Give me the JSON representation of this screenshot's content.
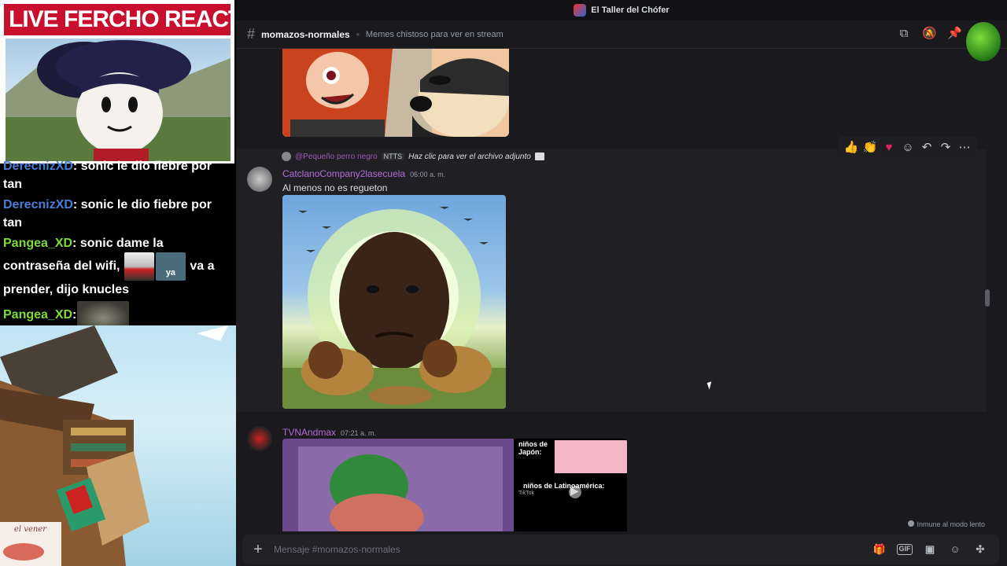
{
  "stream": {
    "cam_title": "LIVE FERCHO REACTION",
    "chat": [
      {
        "user": "DerecnizXD",
        "text": ": sonic le dio fiebre por tan"
      },
      {
        "user": "DerecnizXD",
        "text": ": sonic le dio fiebre por tan"
      },
      {
        "user": "Pangea_XD",
        "text_before": ": sonic dame la contraseña del wifi, ",
        "emote_label": "ya",
        "text_after": " va a prender, dijo knucles"
      },
      {
        "user": "Pangea_XD",
        "text": ":"
      }
    ],
    "signature": "el vener"
  },
  "discord": {
    "window_title": "El Taller del Chófer",
    "channel": {
      "name": "momazos-normales",
      "topic": "Memes chistoso para ver en stream"
    },
    "reply": {
      "user": "@Pequeño perro negro",
      "tag": "NTTS",
      "hint": "Haz clic para ver el archivo adjunto"
    },
    "messages": [
      {
        "author": "CatclanoCompany2lasecuela",
        "time": "06:00 a. m.",
        "text": "Al menos no es regueton"
      },
      {
        "author": "TVNAndmax",
        "time": "07:21 a. m."
      }
    ],
    "video_caption": {
      "top": "niños de Japón:",
      "bottom": "niños de Latinoamérica:",
      "brand": "TikTok"
    },
    "slowmode": "Inmune al modo lento",
    "composer": {
      "placeholder": "Mensaje #momazos-normales",
      "gif": "GIF"
    },
    "colors": {
      "accent": "#c8102e",
      "author": "#b36bd6",
      "blue_user": "#4a7dd8",
      "green_user": "#7ddc3c"
    }
  }
}
